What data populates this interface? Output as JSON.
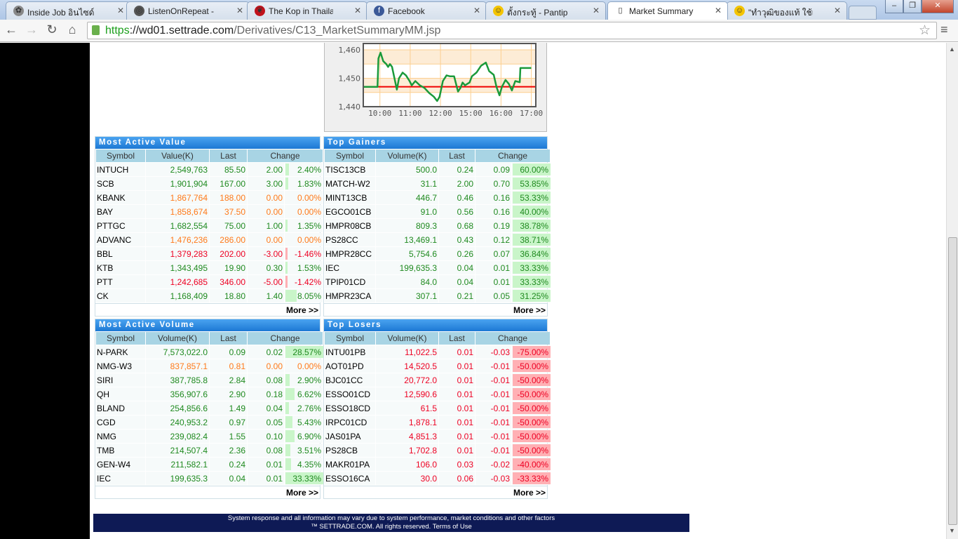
{
  "browser": {
    "tabs": [
      {
        "label": "Inside Job อินไซด์ จ็อบ",
        "icon": "flower-icon"
      },
      {
        "label": "ListenOnRepeat - Bedr",
        "icon": "repeat-icon"
      },
      {
        "label": "The Kop in Thailand -",
        "icon": "liverbird-icon"
      },
      {
        "label": "Facebook",
        "icon": "facebook-icon"
      },
      {
        "label": "ตั้งกระทู้ - Pantip",
        "icon": "smiley-icon"
      },
      {
        "label": "Market Summary",
        "icon": "page-icon"
      },
      {
        "label": "\"ทำวุฒิของแท้ ใช้เรียน",
        "icon": "smiley-icon"
      }
    ],
    "active_tab": 5,
    "url_scheme": "https",
    "url_host": "://wd01.settrade.com",
    "url_path": "/Derivatives/C13_MarketSummaryMM.jsp"
  },
  "chart_data": {
    "type": "line",
    "title": "",
    "y_ticks": [
      "1,440",
      "1,450",
      "1,460"
    ],
    "y_tick_values": [
      1440,
      1450,
      1460
    ],
    "x_ticks": [
      "10:00",
      "11:00",
      "12:00",
      "15:00",
      "16:00",
      "17:00"
    ],
    "ylim": [
      1440,
      1460
    ],
    "xlim_tick_index": [
      -0.55,
      5.15
    ],
    "reference_line": 1447,
    "colors": {
      "line": "#1a9a3a",
      "reference": "#ee0000",
      "band": "#fdecd6",
      "grid": "#fccf90"
    },
    "series": [
      {
        "name": "index",
        "x": [
          -0.55,
          -0.08,
          -0.05,
          0.02,
          0.11,
          0.21,
          0.27,
          0.33,
          0.4,
          0.56,
          0.63,
          0.75,
          0.86,
          0.98,
          1.05,
          1.17,
          1.32,
          1.47,
          1.63,
          1.78,
          1.89,
          1.97,
          2.08,
          2.2,
          2.31,
          2.45,
          2.58,
          2.66,
          2.73,
          2.81,
          2.96,
          3.04,
          3.19,
          3.34,
          3.5,
          3.61,
          3.76,
          3.85,
          3.95,
          4.03,
          4.15,
          4.26,
          4.36,
          4.47,
          4.62,
          4.64,
          5.0
        ],
        "y": [
          1447,
          1447,
          1457,
          1459,
          1456,
          1455,
          1454,
          1455,
          1454,
          1446,
          1450,
          1452,
          1451,
          1449,
          1447.5,
          1449,
          1447.5,
          1446.6,
          1444.8,
          1443.5,
          1442,
          1443.5,
          1449,
          1451,
          1450.7,
          1450.7,
          1445.3,
          1446.6,
          1448.5,
          1447.5,
          1448.5,
          1450.7,
          1452,
          1454.4,
          1455.5,
          1452.5,
          1451.2,
          1447,
          1444,
          1447,
          1449.4,
          1448,
          1445.7,
          1449,
          1448.6,
          1453.6,
          1453.6
        ]
      }
    ]
  },
  "tables": [
    {
      "title": "Most Active Value",
      "headers": [
        "Symbol",
        "Value(K)",
        "Last",
        "Change"
      ],
      "rows": [
        [
          "INTUCH",
          "2,549,763",
          "85.50",
          "2.00",
          "2.40%",
          "up"
        ],
        [
          "SCB",
          "1,901,904",
          "167.00",
          "3.00",
          "1.83%",
          "up"
        ],
        [
          "KBANK",
          "1,867,764",
          "188.00",
          "0.00",
          "0.00%",
          "flat"
        ],
        [
          "BAY",
          "1,858,674",
          "37.50",
          "0.00",
          "0.00%",
          "flat"
        ],
        [
          "PTTGC",
          "1,682,554",
          "75.00",
          "1.00",
          "1.35%",
          "up"
        ],
        [
          "ADVANC",
          "1,476,236",
          "286.00",
          "0.00",
          "0.00%",
          "flat"
        ],
        [
          "BBL",
          "1,379,283",
          "202.00",
          "-3.00",
          "-1.46%",
          "down"
        ],
        [
          "KTB",
          "1,343,495",
          "19.90",
          "0.30",
          "1.53%",
          "up"
        ],
        [
          "PTT",
          "1,242,685",
          "346.00",
          "-5.00",
          "-1.42%",
          "down"
        ],
        [
          "CK",
          "1,168,409",
          "18.80",
          "1.40",
          "8.05%",
          "up"
        ]
      ],
      "more": "More >>"
    },
    {
      "title": "Top Gainers",
      "headers": [
        "Symbol",
        "Volume(K)",
        "Last",
        "Change"
      ],
      "rows": [
        [
          "TISC13CB",
          "500.0",
          "0.24",
          "0.09",
          "60.00%",
          "up"
        ],
        [
          "MATCH-W2",
          "31.1",
          "2.00",
          "0.70",
          "53.85%",
          "up"
        ],
        [
          "MINT13CB",
          "446.7",
          "0.46",
          "0.16",
          "53.33%",
          "up"
        ],
        [
          "EGCO01CB",
          "91.0",
          "0.56",
          "0.16",
          "40.00%",
          "up"
        ],
        [
          "HMPR08CB",
          "809.3",
          "0.68",
          "0.19",
          "38.78%",
          "up"
        ],
        [
          "PS28CC",
          "13,469.1",
          "0.43",
          "0.12",
          "38.71%",
          "up"
        ],
        [
          "HMPR28CC",
          "5,754.6",
          "0.26",
          "0.07",
          "36.84%",
          "up"
        ],
        [
          "IEC",
          "199,635.3",
          "0.04",
          "0.01",
          "33.33%",
          "up"
        ],
        [
          "TPIP01CD",
          "84.0",
          "0.04",
          "0.01",
          "33.33%",
          "up"
        ],
        [
          "HMPR23CA",
          "307.1",
          "0.21",
          "0.05",
          "31.25%",
          "up"
        ]
      ],
      "more": "More >>"
    },
    {
      "title": "Most Active Volume",
      "headers": [
        "Symbol",
        "Volume(K)",
        "Last",
        "Change"
      ],
      "rows": [
        [
          "N-PARK",
          "7,573,022.0",
          "0.09",
          "0.02",
          "28.57%",
          "up"
        ],
        [
          "NMG-W3",
          "837,857.1",
          "0.81",
          "0.00",
          "0.00%",
          "flat"
        ],
        [
          "SIRI",
          "387,785.8",
          "2.84",
          "0.08",
          "2.90%",
          "up"
        ],
        [
          "QH",
          "356,907.6",
          "2.90",
          "0.18",
          "6.62%",
          "up"
        ],
        [
          "BLAND",
          "254,856.6",
          "1.49",
          "0.04",
          "2.76%",
          "up"
        ],
        [
          "CGD",
          "240,953.2",
          "0.97",
          "0.05",
          "5.43%",
          "up"
        ],
        [
          "NMG",
          "239,082.4",
          "1.55",
          "0.10",
          "6.90%",
          "up"
        ],
        [
          "TMB",
          "214,507.4",
          "2.36",
          "0.08",
          "3.51%",
          "up"
        ],
        [
          "GEN-W4",
          "211,582.1",
          "0.24",
          "0.01",
          "4.35%",
          "up"
        ],
        [
          "IEC",
          "199,635.3",
          "0.04",
          "0.01",
          "33.33%",
          "up"
        ]
      ],
      "more": "More >>"
    },
    {
      "title": "Top Losers",
      "headers": [
        "Symbol",
        "Volume(K)",
        "Last",
        "Change"
      ],
      "rows": [
        [
          "INTU01PB",
          "11,022.5",
          "0.01",
          "-0.03",
          "-75.00%",
          "down"
        ],
        [
          "AOT01PD",
          "14,520.5",
          "0.01",
          "-0.01",
          "-50.00%",
          "down"
        ],
        [
          "BJC01CC",
          "20,772.0",
          "0.01",
          "-0.01",
          "-50.00%",
          "down"
        ],
        [
          "ESSO01CD",
          "12,590.6",
          "0.01",
          "-0.01",
          "-50.00%",
          "down"
        ],
        [
          "ESSO18CD",
          "61.5",
          "0.01",
          "-0.01",
          "-50.00%",
          "down"
        ],
        [
          "IRPC01CD",
          "1,878.1",
          "0.01",
          "-0.01",
          "-50.00%",
          "down"
        ],
        [
          "JAS01PA",
          "4,851.3",
          "0.01",
          "-0.01",
          "-50.00%",
          "down"
        ],
        [
          "PS28CB",
          "1,702.8",
          "0.01",
          "-0.01",
          "-50.00%",
          "down"
        ],
        [
          "MAKR01PA",
          "106.0",
          "0.03",
          "-0.02",
          "-40.00%",
          "down"
        ],
        [
          "ESSO16CA",
          "30.0",
          "0.06",
          "-0.03",
          "-33.33%",
          "down"
        ]
      ],
      "more": "More >>"
    }
  ],
  "footer": {
    "line1": "System response and all information may vary due to system performance, market conditions and other factors",
    "line2": "™ SETTRADE.COM. All rights reserved. Terms of Use"
  }
}
